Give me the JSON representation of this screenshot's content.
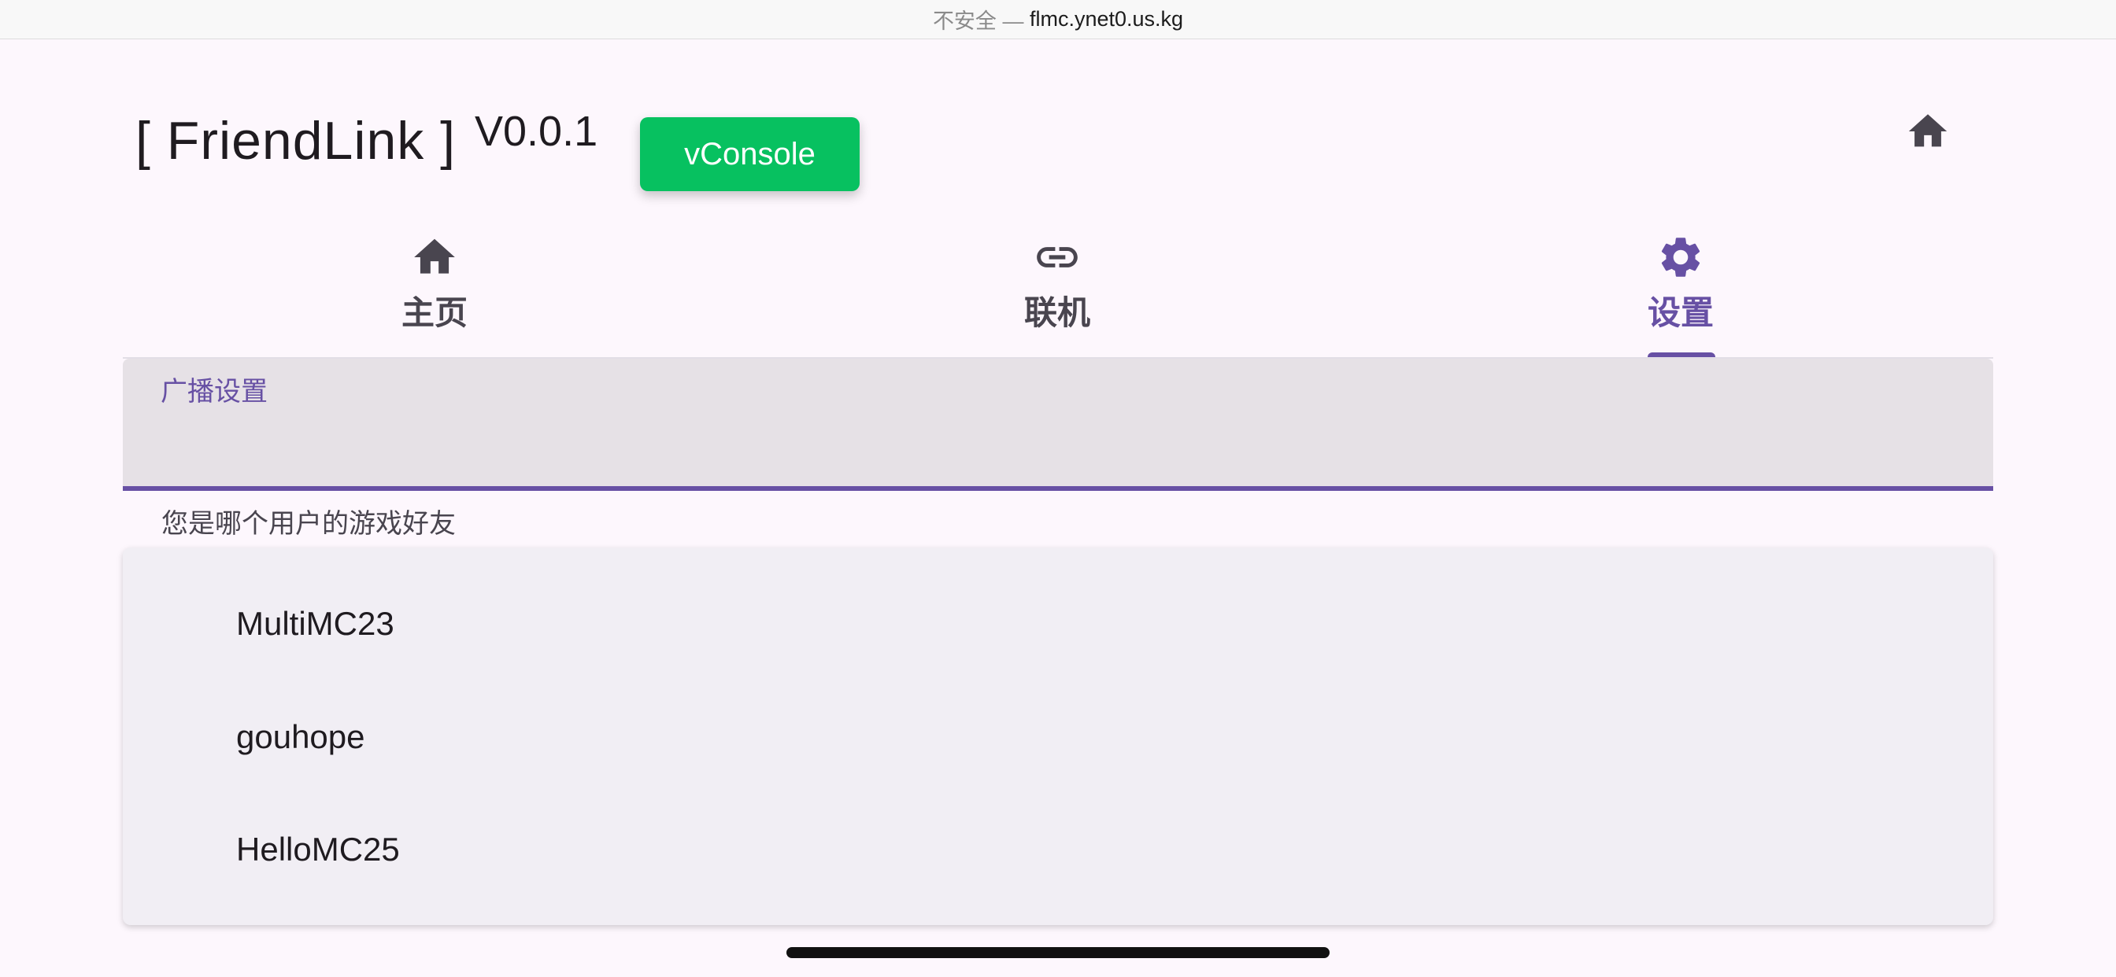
{
  "browser": {
    "insecure_label": "不安全 —",
    "domain": "flmc.ynet0.us.kg"
  },
  "header": {
    "title": "[ FriendLink ]",
    "version": "V0.0.1",
    "vconsole_label": "vConsole",
    "home_icon": "home-icon"
  },
  "tabs": [
    {
      "label": "主页",
      "icon": "home-icon",
      "active": false
    },
    {
      "label": "联机",
      "icon": "link-icon",
      "active": false
    },
    {
      "label": "设置",
      "icon": "gear-icon",
      "active": true
    }
  ],
  "settings": {
    "field_label": "广播设置",
    "field_value": "",
    "helper_text": "您是哪个用户的游戏好友",
    "options": [
      "MultiMC23",
      "gouhope",
      "HelloMC25"
    ]
  },
  "colors": {
    "primary": "#6750a4",
    "vconsole_green": "#07c160",
    "background": "#fdf7fd",
    "field_bg": "#e6e1e6",
    "menu_bg": "#f1eef4"
  }
}
